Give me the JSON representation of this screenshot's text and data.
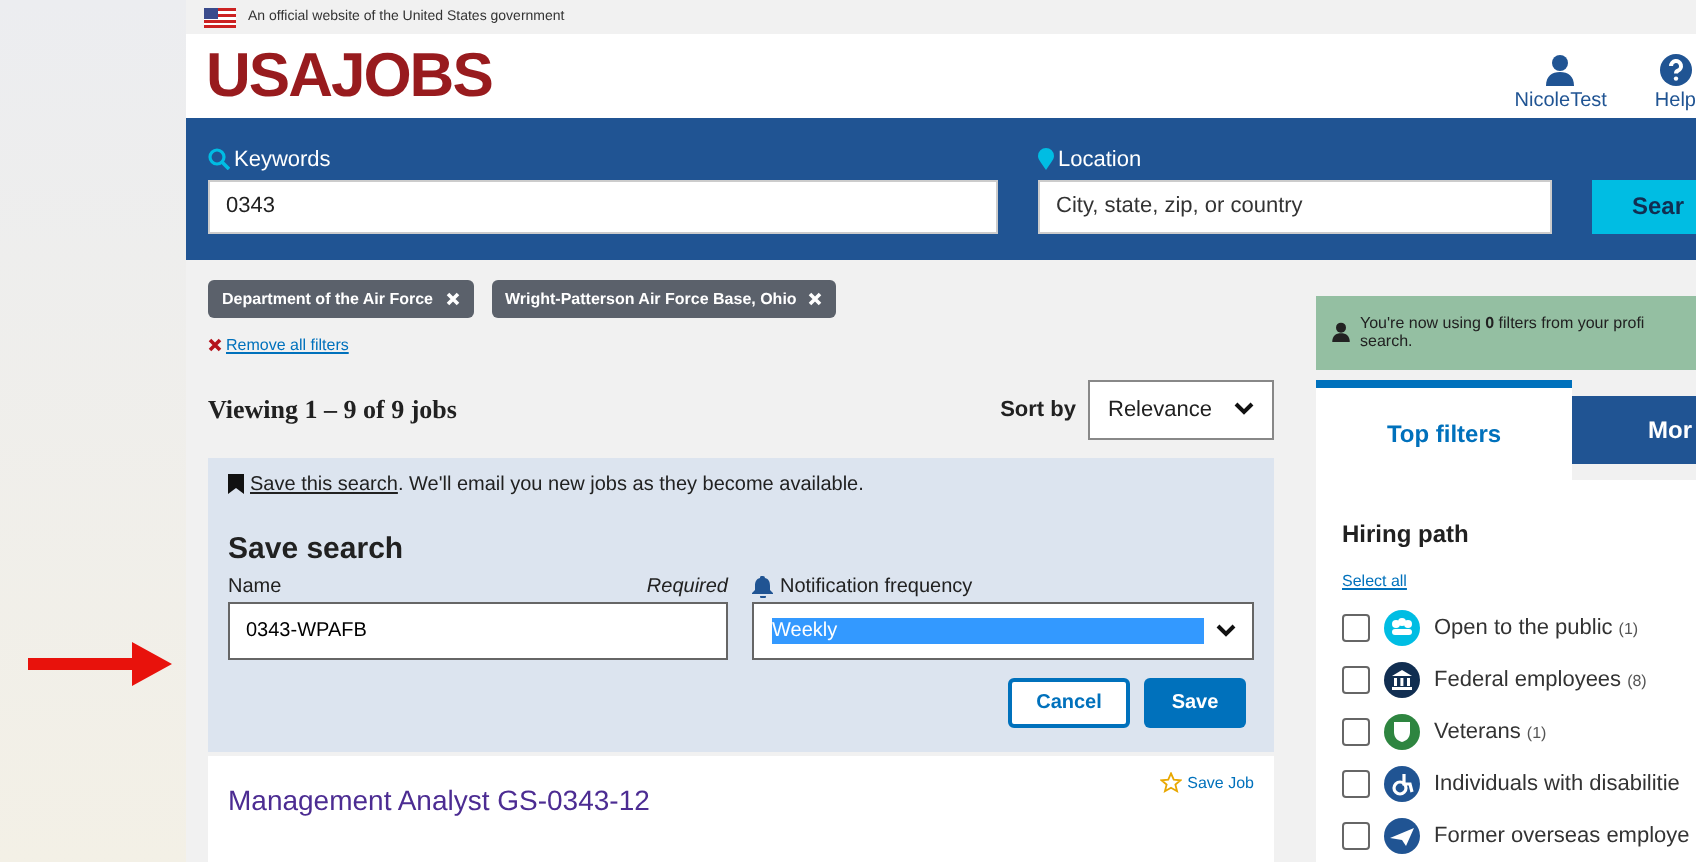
{
  "gov_banner": "An official website of the United States government",
  "logo": "USAJOBS",
  "user_nav": [
    {
      "label": "NicoleTest",
      "kind": "user"
    },
    {
      "label": "Help",
      "kind": "help"
    }
  ],
  "search": {
    "keywords_label": "Keywords",
    "keywords_value": "0343",
    "location_label": "Location",
    "location_placeholder": "City, state, zip, or country",
    "button": "Sear"
  },
  "filter_chips": [
    "Department of the Air Force",
    "Wright-Patterson Air Force Base, Ohio"
  ],
  "remove_all": "Remove all filters",
  "results_heading": "Viewing 1 – 9 of 9 jobs",
  "sort": {
    "label": "Sort by",
    "value": "Relevance"
  },
  "save_notice": {
    "link": "Save this search",
    "text": ". We'll email you new jobs as they become available."
  },
  "save_form": {
    "title": "Save search",
    "name_label": "Name",
    "required": "Required",
    "name_value": "0343-WPAFB",
    "frequency_label": "Notification frequency",
    "frequency_value": "Weekly",
    "buttons": [
      {
        "label": "Cancel",
        "kind": "secondary"
      },
      {
        "label": "Save",
        "kind": "primary"
      }
    ]
  },
  "job": {
    "title": "Management Analyst GS-0343-12",
    "save": "Save Job"
  },
  "profile_notice": [
    "You're now using **0** filters from your profi",
    "search."
  ],
  "tabs": [
    {
      "label": "Top filters",
      "selected": true
    },
    {
      "label": "Mor",
      "selected": false
    }
  ],
  "hiring_path": {
    "title": "Hiring path",
    "select_all": "Select all",
    "items": [
      {
        "label": "Open to the public",
        "count": "(1)",
        "checked": false,
        "kind": "public",
        "color": "#00bde3"
      },
      {
        "label": "Federal employees",
        "count": "(8)",
        "checked": false,
        "kind": "federal",
        "color": "#112e51"
      },
      {
        "label": "Veterans",
        "count": "(1)",
        "checked": false,
        "kind": "veterans",
        "color": "#2e8540"
      },
      {
        "label": "Individuals with disabilitie",
        "checked": false,
        "kind": "disability",
        "color": "#205493"
      },
      {
        "label": "Former overseas employe",
        "checked": false,
        "kind": "overseas",
        "color": "#205493"
      }
    ]
  }
}
